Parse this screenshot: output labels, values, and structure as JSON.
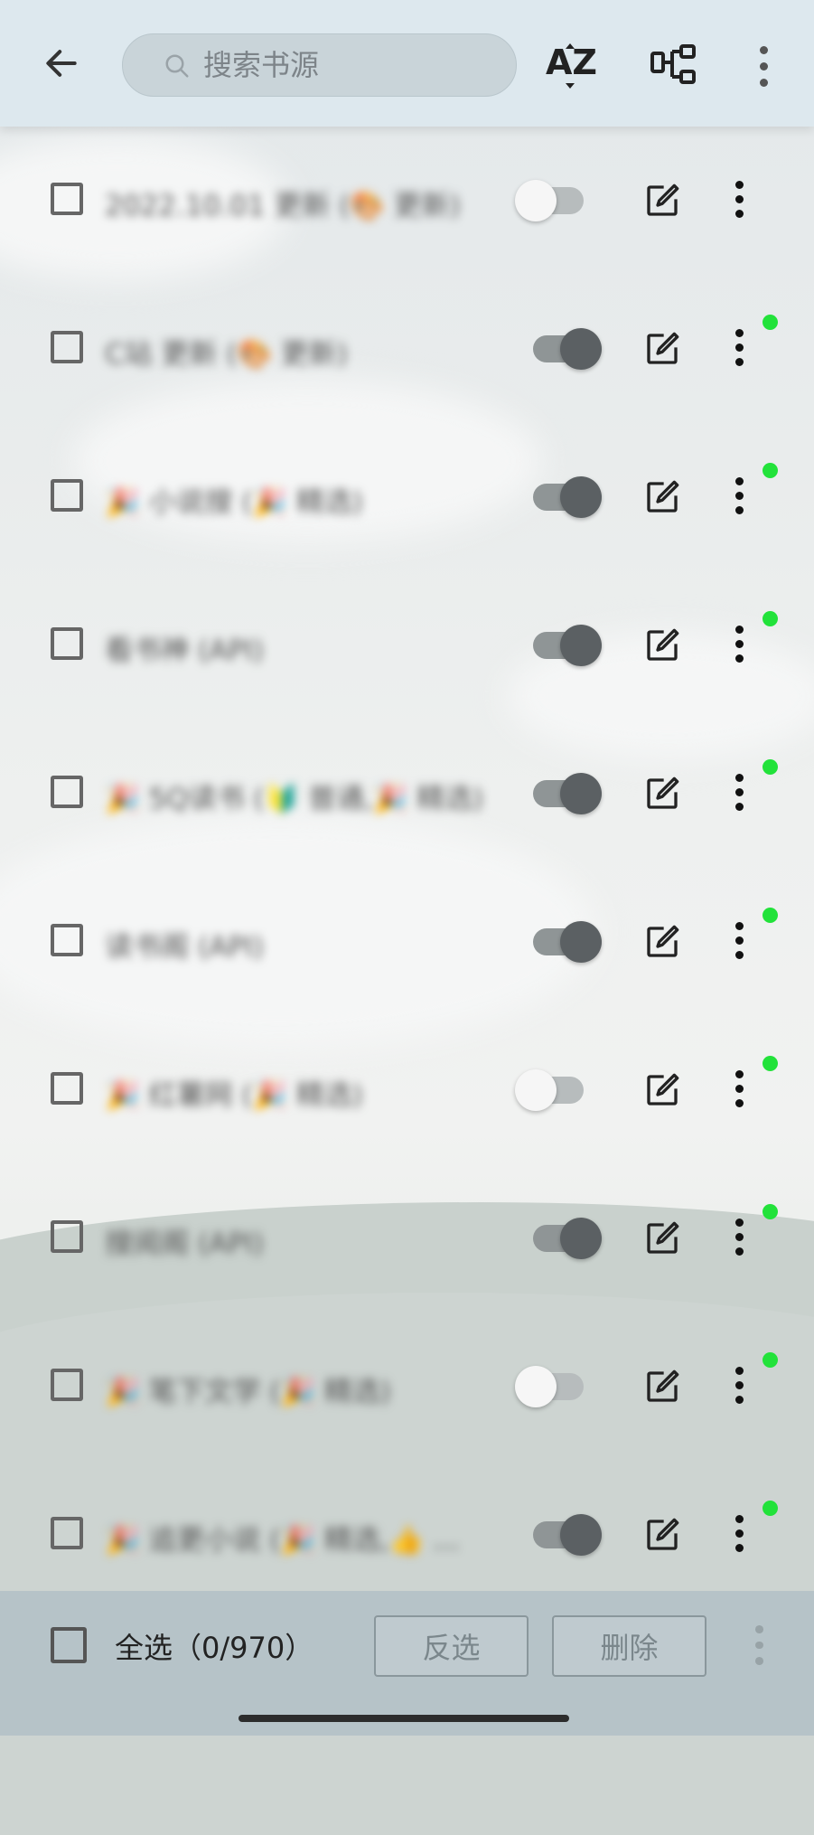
{
  "header": {
    "search_placeholder": "搜索书源",
    "sort_label": "AZ",
    "icons": {
      "back": "arrow-left-icon",
      "search": "search-icon",
      "sort": "sort-az-icon",
      "group": "tree-icon",
      "menu": "more-vertical-icon"
    }
  },
  "sources": [
    {
      "name": "2022.10.01 更新 (🎨 更新)",
      "enabled": false,
      "status_dot": false
    },
    {
      "name": "C站 更新 (🎨 更新)",
      "enabled": true,
      "status_dot": true
    },
    {
      "name": "🎉 小说搜 (🎉 精选)",
      "enabled": true,
      "status_dot": true
    },
    {
      "name": "看书神 (API)",
      "enabled": true,
      "status_dot": true
    },
    {
      "name": "🎉 5Q读书 (🔰 普通,🎉 精选)",
      "enabled": true,
      "status_dot": true
    },
    {
      "name": "读书阁 (API)",
      "enabled": true,
      "status_dot": true
    },
    {
      "name": "🎉 红薯网 (🎉 精选)",
      "enabled": false,
      "status_dot": true
    },
    {
      "name": "搜阅阁 (API)",
      "enabled": true,
      "status_dot": true
    },
    {
      "name": "🎉 笔下文学 (🎉 精选)",
      "enabled": false,
      "status_dot": true
    },
    {
      "name": "🎉 追更小说 (🎉 精选,👍 ...",
      "enabled": true,
      "status_dot": true
    }
  ],
  "footer": {
    "select_all_label": "全选（0/970）",
    "invert_label": "反选",
    "delete_label": "删除"
  },
  "colors": {
    "status_dot": "#22e23a",
    "header_bg": "#dde8ee",
    "footer_bg": "#b6c3c8"
  }
}
